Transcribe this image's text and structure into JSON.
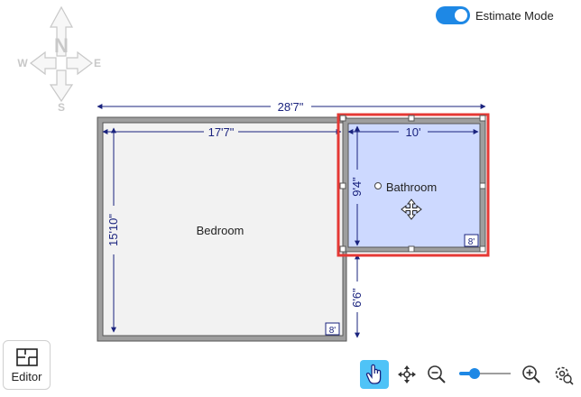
{
  "mode_toggle": {
    "label": "Estimate Mode",
    "enabled": true
  },
  "compass": {
    "north": "N",
    "south": "S",
    "east": "E",
    "west": "W"
  },
  "dimensions": {
    "overall_width": "28'7\"",
    "bedroom_width": "17'7\"",
    "bedroom_height": "15'10\"",
    "bathroom_width": "10'",
    "bathroom_height": "9'4\"",
    "below_bathroom": "6'6\""
  },
  "rooms": {
    "bedroom": {
      "name": "Bedroom",
      "ceiling": "8'"
    },
    "bathroom": {
      "name": "Bathroom",
      "ceiling": "8'"
    }
  },
  "editor_button": {
    "label": "Editor"
  },
  "toolbar": {
    "tools": [
      "pointer-hand-icon",
      "move-icon",
      "zoom-out-icon",
      "zoom-slider",
      "zoom-in-icon",
      "settings-icon"
    ],
    "zoom_level": 0.3
  },
  "colors": {
    "accent": "#1e88e5",
    "selection": "#e53935",
    "bathroom_fill": "#cdd9ff",
    "wall": "#9e9e9e"
  }
}
